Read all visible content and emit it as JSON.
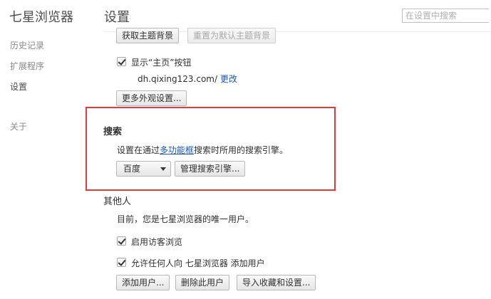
{
  "app": {
    "title": "七星浏览器"
  },
  "sidebar": {
    "items": [
      {
        "label": "历史记录"
      },
      {
        "label": "扩展程序"
      },
      {
        "label": "设置"
      },
      {
        "label": "关于"
      }
    ]
  },
  "header": {
    "title": "设置",
    "search_placeholder": "在设置中搜索"
  },
  "appearance": {
    "get_theme_label": "获取主题背景",
    "reset_theme_label": "重置为默认主题背景",
    "show_home_label": "显示“主页”按钮",
    "show_home_checked": true,
    "home_url": "dh.qixing123.com/",
    "change_link": "更改",
    "more_appearance_label": "更多外观设置..."
  },
  "search": {
    "title": "搜索",
    "desc_prefix": "设置在通过",
    "desc_link": "多功能框",
    "desc_suffix": "搜索时所用的搜索引擎。",
    "engine_selected": "百度",
    "manage_label": "管理搜索引擎..."
  },
  "people": {
    "title": "其他人",
    "desc": "目前，您是七星浏览器的唯一用户。",
    "guest_label": "启用访客浏览",
    "guest_checked": true,
    "allow_add_label": "允许任何人向 七星浏览器 添加用户",
    "allow_add_checked": true,
    "add_user_label": "添加用户...",
    "delete_user_label": "删除此用户",
    "import_label": "导入收藏和设置..."
  },
  "colors": {
    "highlight": "#e03a3a",
    "link": "#1a55c8"
  }
}
